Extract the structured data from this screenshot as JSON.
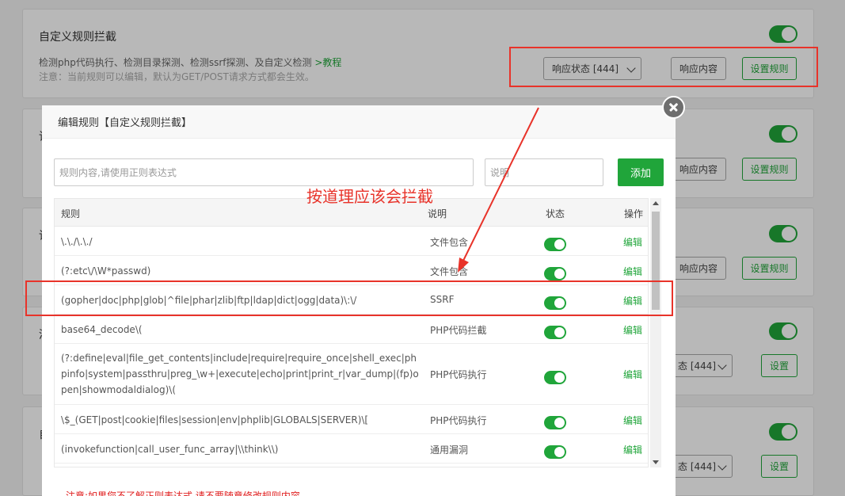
{
  "background": {
    "top_card": {
      "title": "自定义规则拦截",
      "desc": "检测php代码执行、检测目录探测、检测ssrf探测、及自定义检测",
      "tutorial_link": ">教程",
      "note": "注意：当前规则可以编辑，默认为GET/POST请求方式都会生效。",
      "status_select": "响应状态 [444]",
      "response_button": "响应内容",
      "rules_button": "设置规则"
    },
    "card2": {
      "title_fragment": "请",
      "response_button": "响应内容",
      "rules_button": "设置规则"
    },
    "card3": {
      "title_fragment": "请",
      "response_button": "响应内容",
      "rules_button": "设置规则"
    },
    "card4": {
      "title_fragment": "清",
      "status_select": "态 [444]",
      "set_button": "设置"
    },
    "card5": {
      "title_fragment": "自",
      "status_select": "态 [444]",
      "set_button": "设置"
    }
  },
  "modal": {
    "title": "编辑规则【自定义规则拦截】",
    "rule_input_placeholder": "规则内容,请使用正则表达式",
    "desc_input_placeholder": "说明",
    "add_button": "添加",
    "columns": [
      "规则",
      "说明",
      "状态",
      "操作"
    ],
    "rows": [
      {
        "rule": "\\.\\./\\.\\./",
        "desc": "文件包含",
        "enabled": true,
        "action": "编辑"
      },
      {
        "rule": "(?:etc\\/\\W*passwd)",
        "desc": "文件包含",
        "enabled": true,
        "action": "编辑"
      },
      {
        "rule": "(gopher|doc|php|glob|^file|phar|zlib|ftp|ldap|dict|ogg|data)\\:\\/",
        "desc": "SSRF",
        "enabled": true,
        "action": "编辑"
      },
      {
        "rule": "base64_decode\\(",
        "desc": "PHP代码拦截",
        "enabled": true,
        "action": "编辑"
      },
      {
        "rule": "(?:define|eval|file_get_contents|include|require|require_once|shell_exec|phpinfo|system|passthru|preg_\\w+|execute|echo|print|print_r|var_dump|(fp)open|showmodaldialog)\\(",
        "desc": "PHP代码执行",
        "enabled": true,
        "action": "编辑"
      },
      {
        "rule": "\\$_(GET|post|cookie|files|session|env|phplib|GLOBALS|SERVER)\\[",
        "desc": "PHP代码执行",
        "enabled": true,
        "action": "编辑"
      },
      {
        "rule": "(invokefunction|call_user_func_array|\\\\think\\\\)",
        "desc": "通用漏洞",
        "enabled": true,
        "action": "编辑"
      }
    ],
    "bottom_note": "注意:如果您不了解正则表达式,请不要随意修改规则内容"
  },
  "annotation": {
    "text": "按道理应该会拦截",
    "color": "#e8332a"
  },
  "colors": {
    "accent": "#20a53a",
    "annotation": "#e8332a"
  }
}
